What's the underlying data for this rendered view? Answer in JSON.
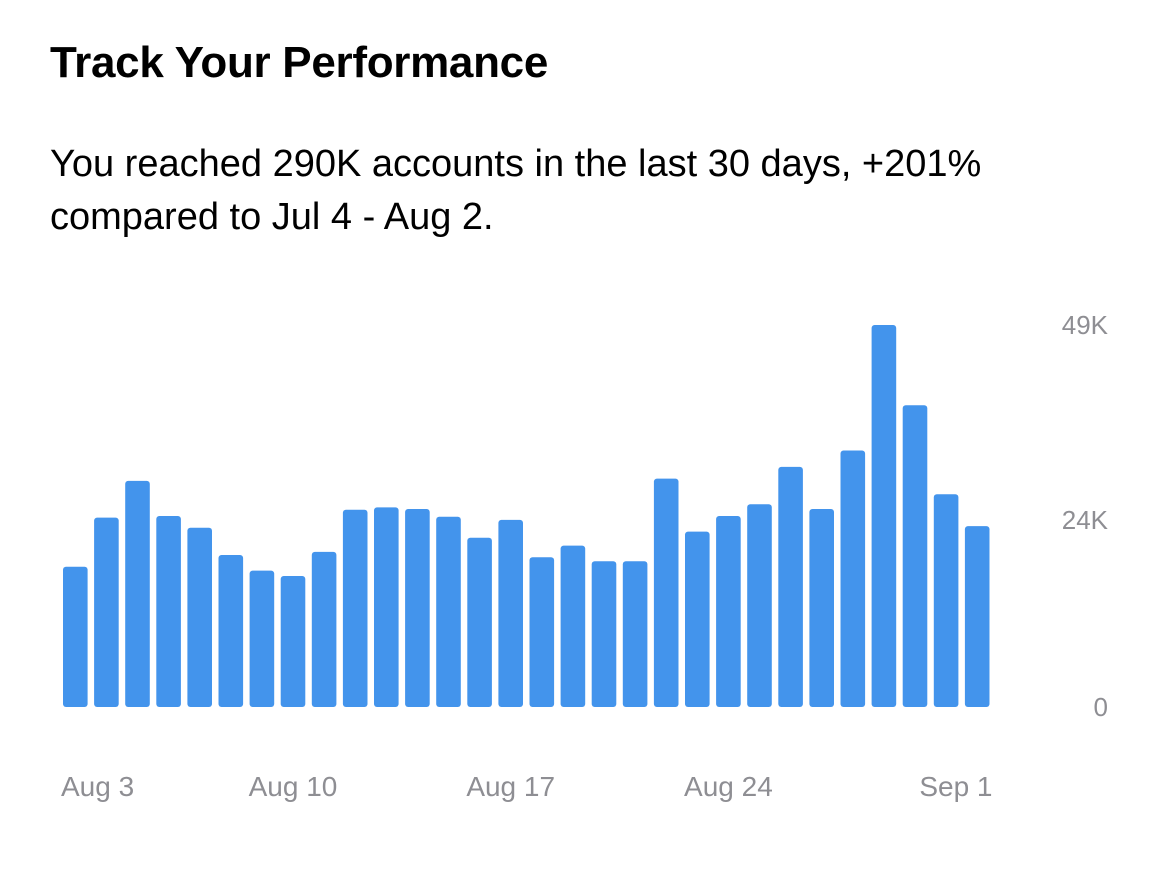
{
  "header": {
    "title": "Track Your Performance",
    "summary": "You reached 290K accounts in the last 30 days, +201% compared to Jul 4 - Aug 2."
  },
  "colors": {
    "bar": "#4394ec",
    "tick_text": "#8e8e93"
  },
  "chart_data": {
    "type": "bar",
    "title": "",
    "xlabel": "",
    "ylabel": "",
    "ylim": [
      0,
      49000
    ],
    "y_ticks": [
      {
        "value": 49000,
        "label": "49K"
      },
      {
        "value": 24000,
        "label": "24K"
      },
      {
        "value": 0,
        "label": "0"
      }
    ],
    "x_tick_labels": [
      {
        "index": 0,
        "label": "Aug 3"
      },
      {
        "index": 7,
        "label": "Aug 10"
      },
      {
        "index": 14,
        "label": "Aug 17"
      },
      {
        "index": 21,
        "label": "Aug 24"
      },
      {
        "index": 29,
        "label": "Sep 1"
      }
    ],
    "categories": [
      "Aug 3",
      "Aug 4",
      "Aug 5",
      "Aug 6",
      "Aug 7",
      "Aug 8",
      "Aug 9",
      "Aug 10",
      "Aug 11",
      "Aug 12",
      "Aug 13",
      "Aug 14",
      "Aug 15",
      "Aug 16",
      "Aug 17",
      "Aug 18",
      "Aug 19",
      "Aug 20",
      "Aug 21",
      "Aug 22",
      "Aug 23",
      "Aug 24",
      "Aug 25",
      "Aug 26",
      "Aug 27",
      "Aug 28",
      "Aug 29",
      "Aug 30",
      "Aug 31",
      "Sep 1"
    ],
    "values": [
      18000,
      24300,
      29000,
      24500,
      23000,
      19500,
      17500,
      16800,
      19900,
      25300,
      25600,
      25400,
      24400,
      21700,
      24000,
      19200,
      20700,
      18700,
      18700,
      29300,
      22500,
      24500,
      26000,
      30800,
      25400,
      32900,
      49000,
      38700,
      27300,
      23200
    ]
  }
}
